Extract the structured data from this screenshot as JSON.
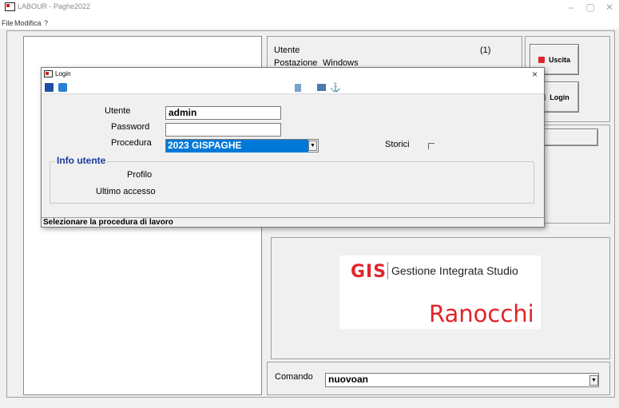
{
  "window": {
    "title": "LABOUR - Paghe2022",
    "controls": [
      "–",
      "▢",
      "✕"
    ]
  },
  "menu": {
    "items": [
      "File",
      "Modifica",
      "?"
    ]
  },
  "info_panel": {
    "utente_label": "Utente",
    "utente_count": "(1)",
    "postazione_label": "Postazione",
    "postazione_value": "Windows"
  },
  "buttons": {
    "uscita": "Uscita",
    "login": "Login"
  },
  "login_dialog": {
    "title": "Login",
    "close": "×",
    "fields": {
      "utente_label": "Utente",
      "utente_value": "admin",
      "password_label": "Password",
      "password_value": "",
      "procedura_label": "Procedura",
      "procedura_value": "2023 GISPAGHE",
      "storici_label": "Storici"
    },
    "info_group": {
      "title": "Info utente",
      "profilo_label": "Profilo",
      "ultimo_accesso_label": "Ultimo accesso"
    },
    "status": "Selezionare la procedura di lavoro"
  },
  "logo": {
    "gis": "GIS",
    "subtitle": "Gestione Integrata Studio",
    "brand": "Ranocchi"
  },
  "command": {
    "label": "Comando",
    "value": "nuovoan"
  },
  "colors": {
    "brand_red": "#e0252c",
    "selection_blue": "#0078d7",
    "group_title": "#1a3a9a"
  }
}
